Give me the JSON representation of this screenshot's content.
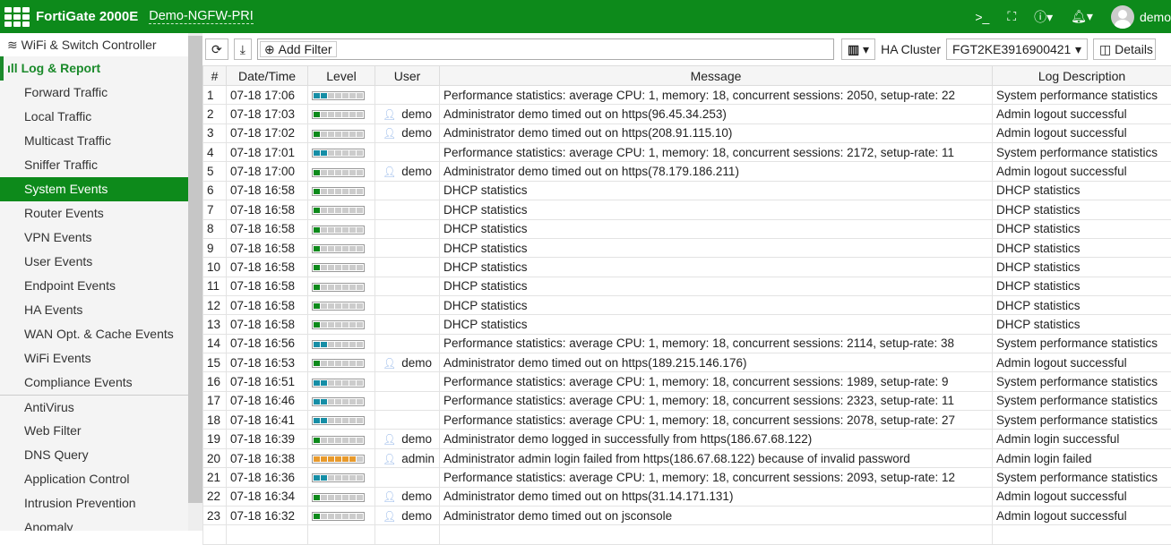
{
  "header": {
    "product": "FortiGate 2000E",
    "hostname": "Demo-NGFW-PRI",
    "user": "demo"
  },
  "sidebar": {
    "items": [
      {
        "label": "WiFi & Switch Controller",
        "type": "top"
      },
      {
        "label": "Log & Report",
        "type": "sec"
      },
      {
        "label": "Forward Traffic"
      },
      {
        "label": "Local Traffic"
      },
      {
        "label": "Multicast Traffic"
      },
      {
        "label": "Sniffer Traffic"
      },
      {
        "label": "System Events",
        "active": true
      },
      {
        "label": "Router Events"
      },
      {
        "label": "VPN Events"
      },
      {
        "label": "User Events"
      },
      {
        "label": "Endpoint Events"
      },
      {
        "label": "HA Events"
      },
      {
        "label": "WAN Opt. & Cache Events"
      },
      {
        "label": "WiFi Events"
      },
      {
        "label": "Compliance Events"
      },
      {
        "label": "AntiVirus",
        "div": true
      },
      {
        "label": "Web Filter"
      },
      {
        "label": "DNS Query"
      },
      {
        "label": "Application Control"
      },
      {
        "label": "Intrusion Prevention"
      },
      {
        "label": "Anomaly"
      }
    ]
  },
  "toolbar": {
    "add_filter": "Add Filter",
    "ha_cluster_label": "HA Cluster",
    "ha_cluster_value": "FGT2KE3916900421",
    "details": "Details"
  },
  "table": {
    "columns": [
      "#",
      "Date/Time",
      "Level",
      "User",
      "Message",
      "Log Description"
    ],
    "level_colors": {
      "info": "#168ea6",
      "notice": "#0d8a1b",
      "warning": "#e89a2c"
    },
    "level_fill": {
      "info": 2,
      "notice": 1,
      "warning": 6
    },
    "rows": [
      [
        "1",
        "07-18 17:06",
        "info",
        "",
        "Performance statistics: average CPU: 1, memory: 18, concurrent sessions: 2050, setup-rate: 22",
        "System performance statistics"
      ],
      [
        "2",
        "07-18 17:03",
        "notice",
        "demo",
        "Administrator demo timed out on https(96.45.34.253)",
        "Admin logout successful"
      ],
      [
        "3",
        "07-18 17:02",
        "notice",
        "demo",
        "Administrator demo timed out on https(208.91.115.10)",
        "Admin logout successful"
      ],
      [
        "4",
        "07-18 17:01",
        "info",
        "",
        "Performance statistics: average CPU: 1, memory: 18, concurrent sessions: 2172, setup-rate: 11",
        "System performance statistics"
      ],
      [
        "5",
        "07-18 17:00",
        "notice",
        "demo",
        "Administrator demo timed out on https(78.179.186.211)",
        "Admin logout successful"
      ],
      [
        "6",
        "07-18 16:58",
        "notice",
        "",
        "DHCP statistics",
        "DHCP statistics"
      ],
      [
        "7",
        "07-18 16:58",
        "notice",
        "",
        "DHCP statistics",
        "DHCP statistics"
      ],
      [
        "8",
        "07-18 16:58",
        "notice",
        "",
        "DHCP statistics",
        "DHCP statistics"
      ],
      [
        "9",
        "07-18 16:58",
        "notice",
        "",
        "DHCP statistics",
        "DHCP statistics"
      ],
      [
        "10",
        "07-18 16:58",
        "notice",
        "",
        "DHCP statistics",
        "DHCP statistics"
      ],
      [
        "11",
        "07-18 16:58",
        "notice",
        "",
        "DHCP statistics",
        "DHCP statistics"
      ],
      [
        "12",
        "07-18 16:58",
        "notice",
        "",
        "DHCP statistics",
        "DHCP statistics"
      ],
      [
        "13",
        "07-18 16:58",
        "notice",
        "",
        "DHCP statistics",
        "DHCP statistics"
      ],
      [
        "14",
        "07-18 16:56",
        "info",
        "",
        "Performance statistics: average CPU: 1, memory: 18, concurrent sessions: 2114, setup-rate: 38",
        "System performance statistics"
      ],
      [
        "15",
        "07-18 16:53",
        "notice",
        "demo",
        "Administrator demo timed out on https(189.215.146.176)",
        "Admin logout successful"
      ],
      [
        "16",
        "07-18 16:51",
        "info",
        "",
        "Performance statistics: average CPU: 1, memory: 18, concurrent sessions: 1989, setup-rate: 9",
        "System performance statistics"
      ],
      [
        "17",
        "07-18 16:46",
        "info",
        "",
        "Performance statistics: average CPU: 1, memory: 18, concurrent sessions: 2323, setup-rate: 11",
        "System performance statistics"
      ],
      [
        "18",
        "07-18 16:41",
        "info",
        "",
        "Performance statistics: average CPU: 1, memory: 18, concurrent sessions: 2078, setup-rate: 27",
        "System performance statistics"
      ],
      [
        "19",
        "07-18 16:39",
        "notice",
        "demo",
        "Administrator demo logged in successfully from https(186.67.68.122)",
        "Admin login successful"
      ],
      [
        "20",
        "07-18 16:38",
        "warning",
        "admin",
        "Administrator admin login failed from https(186.67.68.122) because of invalid password",
        "Admin login failed"
      ],
      [
        "21",
        "07-18 16:36",
        "info",
        "",
        "Performance statistics: average CPU: 1, memory: 18, concurrent sessions: 2093, setup-rate: 12",
        "System performance statistics"
      ],
      [
        "22",
        "07-18 16:34",
        "notice",
        "demo",
        "Administrator demo timed out on https(31.14.171.131)",
        "Admin logout successful"
      ],
      [
        "23",
        "07-18 16:32",
        "notice",
        "demo",
        "Administrator demo timed out on jsconsole",
        "Admin logout successful"
      ]
    ]
  }
}
